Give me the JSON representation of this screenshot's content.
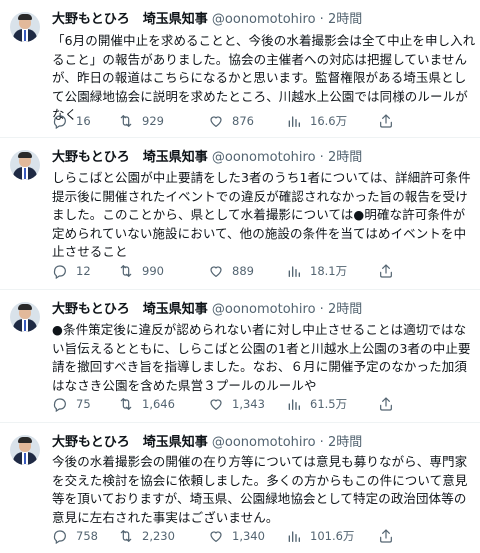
{
  "tweets": [
    {
      "author": "大野もとひろ　埼玉県知事",
      "handle": "@oonomotohiro",
      "sep": "·",
      "time": "2時間",
      "text": "「6月の開催中止を求めることと、今後の水着撮影会は全て中止を申し入れること」の報告がありました。協会の主催者への対応は把握していませんが、昨日の報道はこちらになるかと思います。監督権限がある埼玉県として公園緑地協会に説明を求めたところ、川越水上公園では同様のルールがなく",
      "replies": "16",
      "retweets": "929",
      "likes": "876",
      "views": "16.6万"
    },
    {
      "author": "大野もとひろ　埼玉県知事",
      "handle": "@oonomotohiro",
      "sep": "·",
      "time": "2時間",
      "text": "しらこばと公園が中止要請をした3者のうち1者については、詳細許可条件提示後に開催されたイベントでの違反が確認されなかった旨の報告を受けました。このことから、県として水着撮影については●明確な許可条件が定められていない施設において、他の施設の条件を当てはめイベントを中止させること",
      "replies": "12",
      "retweets": "990",
      "likes": "889",
      "views": "18.1万"
    },
    {
      "author": "大野もとひろ　埼玉県知事",
      "handle": "@oonomotohiro",
      "sep": "·",
      "time": "2時間",
      "text": "●条件策定後に違反が認められない者に対し中止させることは適切ではない旨伝えるとともに、しらこばと公園の1者と川越水上公園の3者の中止要請を撤回すべき旨を指導しました。なお、６月に開催予定のなかった加須はなさき公園を含めた県営３プールのルールや",
      "replies": "75",
      "retweets": "1,646",
      "likes": "1,343",
      "views": "61.5万"
    },
    {
      "author": "大野もとひろ　埼玉県知事",
      "handle": "@oonomotohiro",
      "sep": "·",
      "time": "2時間",
      "text": "今後の水着撮影会の開催の在り方等については意見も募りながら、専門家を交えた検討を協会に依頼しました。多くの方からもこの件について意見等を頂いておりますが、埼玉県、公園緑地協会として特定の政治団体等の意見に左右された事実はございません。",
      "replies": "758",
      "retweets": "2,230",
      "likes": "1,340",
      "views": "101.6万"
    }
  ],
  "icons": {
    "reply": "reply-icon",
    "retweet": "retweet-icon",
    "like": "heart-icon",
    "views": "views-icon",
    "share": "share-icon"
  },
  "colors": {
    "text": "#0f1419",
    "muted": "#536471",
    "divider": "#eff3f4"
  }
}
